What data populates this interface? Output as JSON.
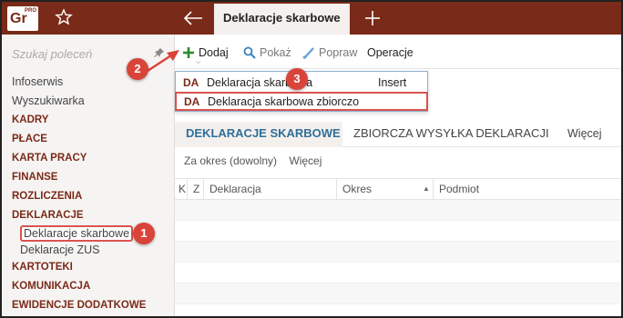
{
  "app": {
    "logo": "Gr",
    "logo_sup": "PRO",
    "active_tab": "Deklaracje skarbowe"
  },
  "sidebar": {
    "search_placeholder": "Szukaj poleceń",
    "items": [
      {
        "label": "Infoserwis",
        "kind": "plain"
      },
      {
        "label": "Wyszukiwarka",
        "kind": "plain"
      },
      {
        "label": "KADRY",
        "kind": "cat"
      },
      {
        "label": "PŁACE",
        "kind": "cat"
      },
      {
        "label": "KARTA PRACY",
        "kind": "cat"
      },
      {
        "label": "FINANSE",
        "kind": "cat"
      },
      {
        "label": "ROZLICZENIA",
        "kind": "cat"
      },
      {
        "label": "DEKLARACJE",
        "kind": "cat"
      }
    ],
    "sub_items": [
      {
        "label": "Deklaracje skarbowe",
        "selected": true
      },
      {
        "label": "Deklaracje ZUS",
        "selected": false
      }
    ],
    "items_after": [
      {
        "label": "KARTOTEKI"
      },
      {
        "label": "KOMUNIKACJA"
      },
      {
        "label": "EWIDENCJE DODATKOWE"
      }
    ]
  },
  "toolbar": {
    "add_label": "Dodaj",
    "show_label": "Pokaż",
    "fix_label": "Popraw",
    "ops_label": "Operacje"
  },
  "dropdown": {
    "items": [
      {
        "badge": "DA",
        "label": "Deklaracja skarbowa",
        "shortcut": "Insert"
      },
      {
        "badge": "DA",
        "label": "Deklaracja skarbowa zbiorczo",
        "shortcut": ""
      }
    ]
  },
  "subtabs": {
    "active": "DEKLARACJE SKARBOWE",
    "other": "ZBIORCZA WYSYŁKA DEKLARACJI",
    "more": "Więcej"
  },
  "filter": {
    "period": "Za okres (dowolny)",
    "more": "Więcej"
  },
  "grid": {
    "columns": [
      "K",
      "Z",
      "Deklaracja",
      "Okres",
      "Podmiot"
    ]
  },
  "steps": [
    "1",
    "2",
    "3"
  ],
  "colors": {
    "brand": "#7a2a18",
    "highlight": "#d9534f",
    "tab_active_text": "#2f6f9a"
  }
}
